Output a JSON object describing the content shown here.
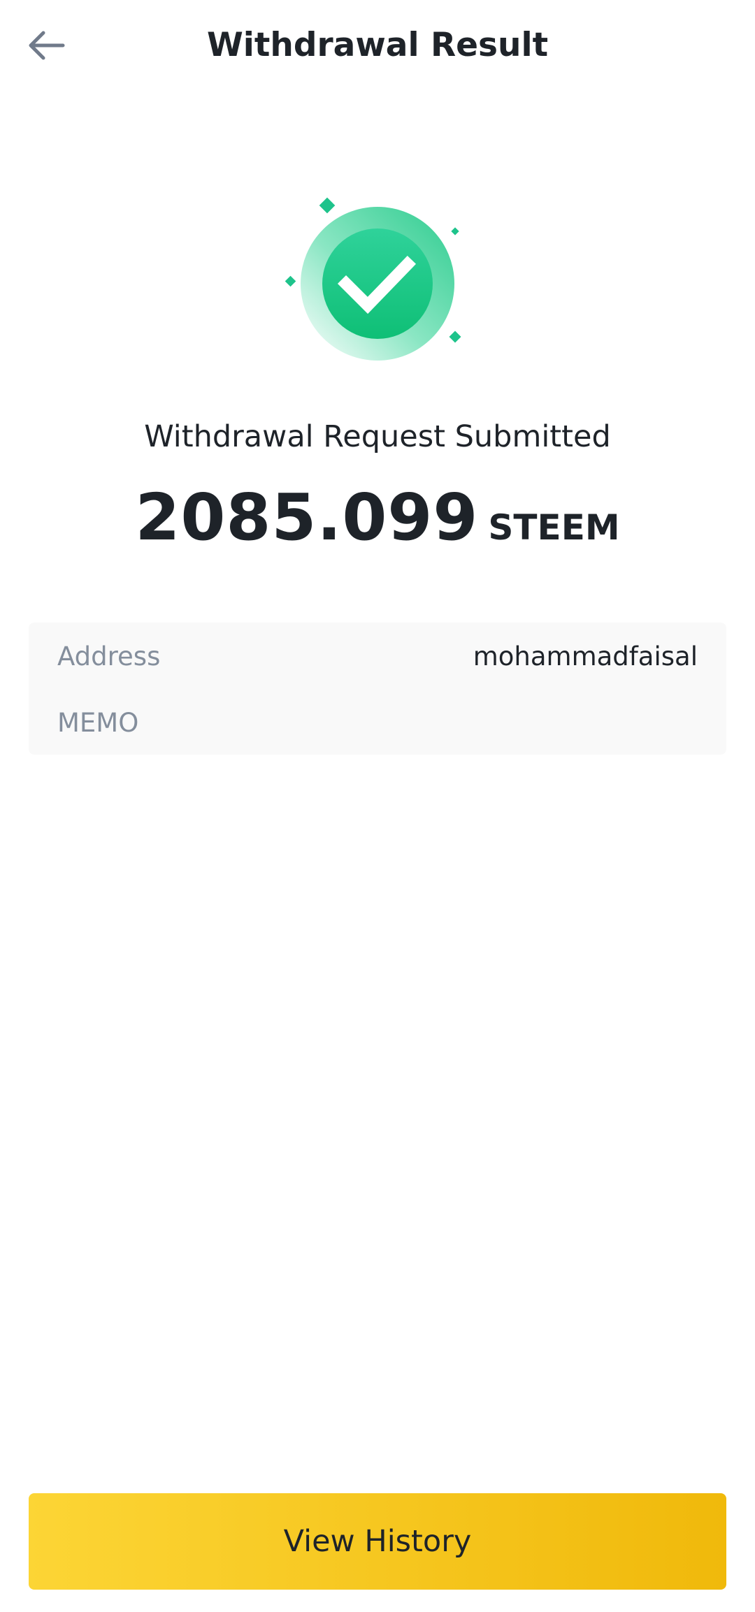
{
  "header": {
    "title": "Withdrawal Result",
    "back_icon": "arrow-left-icon"
  },
  "result": {
    "icon": "success-check-icon",
    "status_text": "Withdrawal Request Submitted",
    "amount": "2085.099",
    "unit": "STEEM"
  },
  "details": [
    {
      "label": "Address",
      "value": "mohammadfaisal"
    },
    {
      "label": "MEMO",
      "value": ""
    }
  ],
  "footer": {
    "button_label": "View History"
  },
  "colors": {
    "accent_green": "#1ec38b",
    "button_yellow_start": "#fcd535",
    "button_yellow_end": "#f0b90b",
    "text_primary": "#1e2329",
    "text_secondary": "#848e9c"
  }
}
